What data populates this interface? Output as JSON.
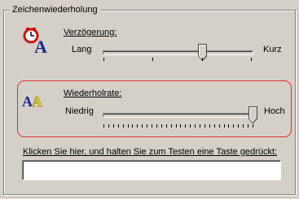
{
  "group": {
    "title": "Zeichenwiederholung"
  },
  "delay": {
    "label": "Verzögerung:",
    "min_label": "Lang",
    "max_label": "Kurz",
    "icon": "stopwatch-A-icon",
    "ticks": 4,
    "value_fraction": 0.67
  },
  "rate": {
    "label": "Wiederholrate:",
    "min_label": "Niedrig",
    "max_label": "Hoch",
    "icon": "repeat-AA-icon",
    "ticks": 32,
    "value_fraction": 1.0
  },
  "test": {
    "label": "Klicken Sie hier, und halten Sie zum Testen eine Taste gedrückt:",
    "value": ""
  },
  "colors": {
    "face": "#d4d0c8",
    "shadow": "#808080",
    "highlight": "#ffffff",
    "focus": "#e03030",
    "icon_red": "#d01010",
    "icon_blue": "#1a2a8a",
    "icon_yellow": "#e8d020"
  }
}
